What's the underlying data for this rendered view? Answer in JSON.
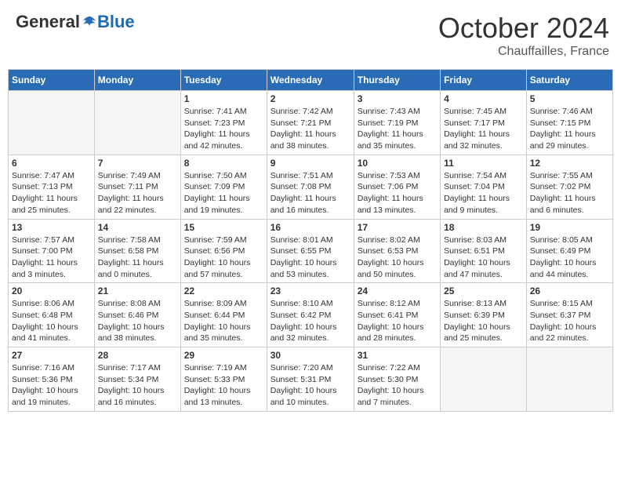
{
  "header": {
    "logo_general": "General",
    "logo_blue": "Blue",
    "month": "October 2024",
    "location": "Chauffailles, France"
  },
  "weekdays": [
    "Sunday",
    "Monday",
    "Tuesday",
    "Wednesday",
    "Thursday",
    "Friday",
    "Saturday"
  ],
  "weeks": [
    [
      {
        "day": "",
        "empty": true
      },
      {
        "day": "",
        "empty": true
      },
      {
        "day": "1",
        "sunrise": "Sunrise: 7:41 AM",
        "sunset": "Sunset: 7:23 PM",
        "daylight": "Daylight: 11 hours and 42 minutes."
      },
      {
        "day": "2",
        "sunrise": "Sunrise: 7:42 AM",
        "sunset": "Sunset: 7:21 PM",
        "daylight": "Daylight: 11 hours and 38 minutes."
      },
      {
        "day": "3",
        "sunrise": "Sunrise: 7:43 AM",
        "sunset": "Sunset: 7:19 PM",
        "daylight": "Daylight: 11 hours and 35 minutes."
      },
      {
        "day": "4",
        "sunrise": "Sunrise: 7:45 AM",
        "sunset": "Sunset: 7:17 PM",
        "daylight": "Daylight: 11 hours and 32 minutes."
      },
      {
        "day": "5",
        "sunrise": "Sunrise: 7:46 AM",
        "sunset": "Sunset: 7:15 PM",
        "daylight": "Daylight: 11 hours and 29 minutes."
      }
    ],
    [
      {
        "day": "6",
        "sunrise": "Sunrise: 7:47 AM",
        "sunset": "Sunset: 7:13 PM",
        "daylight": "Daylight: 11 hours and 25 minutes."
      },
      {
        "day": "7",
        "sunrise": "Sunrise: 7:49 AM",
        "sunset": "Sunset: 7:11 PM",
        "daylight": "Daylight: 11 hours and 22 minutes."
      },
      {
        "day": "8",
        "sunrise": "Sunrise: 7:50 AM",
        "sunset": "Sunset: 7:09 PM",
        "daylight": "Daylight: 11 hours and 19 minutes."
      },
      {
        "day": "9",
        "sunrise": "Sunrise: 7:51 AM",
        "sunset": "Sunset: 7:08 PM",
        "daylight": "Daylight: 11 hours and 16 minutes."
      },
      {
        "day": "10",
        "sunrise": "Sunrise: 7:53 AM",
        "sunset": "Sunset: 7:06 PM",
        "daylight": "Daylight: 11 hours and 13 minutes."
      },
      {
        "day": "11",
        "sunrise": "Sunrise: 7:54 AM",
        "sunset": "Sunset: 7:04 PM",
        "daylight": "Daylight: 11 hours and 9 minutes."
      },
      {
        "day": "12",
        "sunrise": "Sunrise: 7:55 AM",
        "sunset": "Sunset: 7:02 PM",
        "daylight": "Daylight: 11 hours and 6 minutes."
      }
    ],
    [
      {
        "day": "13",
        "sunrise": "Sunrise: 7:57 AM",
        "sunset": "Sunset: 7:00 PM",
        "daylight": "Daylight: 11 hours and 3 minutes."
      },
      {
        "day": "14",
        "sunrise": "Sunrise: 7:58 AM",
        "sunset": "Sunset: 6:58 PM",
        "daylight": "Daylight: 11 hours and 0 minutes."
      },
      {
        "day": "15",
        "sunrise": "Sunrise: 7:59 AM",
        "sunset": "Sunset: 6:56 PM",
        "daylight": "Daylight: 10 hours and 57 minutes."
      },
      {
        "day": "16",
        "sunrise": "Sunrise: 8:01 AM",
        "sunset": "Sunset: 6:55 PM",
        "daylight": "Daylight: 10 hours and 53 minutes."
      },
      {
        "day": "17",
        "sunrise": "Sunrise: 8:02 AM",
        "sunset": "Sunset: 6:53 PM",
        "daylight": "Daylight: 10 hours and 50 minutes."
      },
      {
        "day": "18",
        "sunrise": "Sunrise: 8:03 AM",
        "sunset": "Sunset: 6:51 PM",
        "daylight": "Daylight: 10 hours and 47 minutes."
      },
      {
        "day": "19",
        "sunrise": "Sunrise: 8:05 AM",
        "sunset": "Sunset: 6:49 PM",
        "daylight": "Daylight: 10 hours and 44 minutes."
      }
    ],
    [
      {
        "day": "20",
        "sunrise": "Sunrise: 8:06 AM",
        "sunset": "Sunset: 6:48 PM",
        "daylight": "Daylight: 10 hours and 41 minutes."
      },
      {
        "day": "21",
        "sunrise": "Sunrise: 8:08 AM",
        "sunset": "Sunset: 6:46 PM",
        "daylight": "Daylight: 10 hours and 38 minutes."
      },
      {
        "day": "22",
        "sunrise": "Sunrise: 8:09 AM",
        "sunset": "Sunset: 6:44 PM",
        "daylight": "Daylight: 10 hours and 35 minutes."
      },
      {
        "day": "23",
        "sunrise": "Sunrise: 8:10 AM",
        "sunset": "Sunset: 6:42 PM",
        "daylight": "Daylight: 10 hours and 32 minutes."
      },
      {
        "day": "24",
        "sunrise": "Sunrise: 8:12 AM",
        "sunset": "Sunset: 6:41 PM",
        "daylight": "Daylight: 10 hours and 28 minutes."
      },
      {
        "day": "25",
        "sunrise": "Sunrise: 8:13 AM",
        "sunset": "Sunset: 6:39 PM",
        "daylight": "Daylight: 10 hours and 25 minutes."
      },
      {
        "day": "26",
        "sunrise": "Sunrise: 8:15 AM",
        "sunset": "Sunset: 6:37 PM",
        "daylight": "Daylight: 10 hours and 22 minutes."
      }
    ],
    [
      {
        "day": "27",
        "sunrise": "Sunrise: 7:16 AM",
        "sunset": "Sunset: 5:36 PM",
        "daylight": "Daylight: 10 hours and 19 minutes."
      },
      {
        "day": "28",
        "sunrise": "Sunrise: 7:17 AM",
        "sunset": "Sunset: 5:34 PM",
        "daylight": "Daylight: 10 hours and 16 minutes."
      },
      {
        "day": "29",
        "sunrise": "Sunrise: 7:19 AM",
        "sunset": "Sunset: 5:33 PM",
        "daylight": "Daylight: 10 hours and 13 minutes."
      },
      {
        "day": "30",
        "sunrise": "Sunrise: 7:20 AM",
        "sunset": "Sunset: 5:31 PM",
        "daylight": "Daylight: 10 hours and 10 minutes."
      },
      {
        "day": "31",
        "sunrise": "Sunrise: 7:22 AM",
        "sunset": "Sunset: 5:30 PM",
        "daylight": "Daylight: 10 hours and 7 minutes."
      },
      {
        "day": "",
        "empty": true
      },
      {
        "day": "",
        "empty": true
      }
    ]
  ]
}
